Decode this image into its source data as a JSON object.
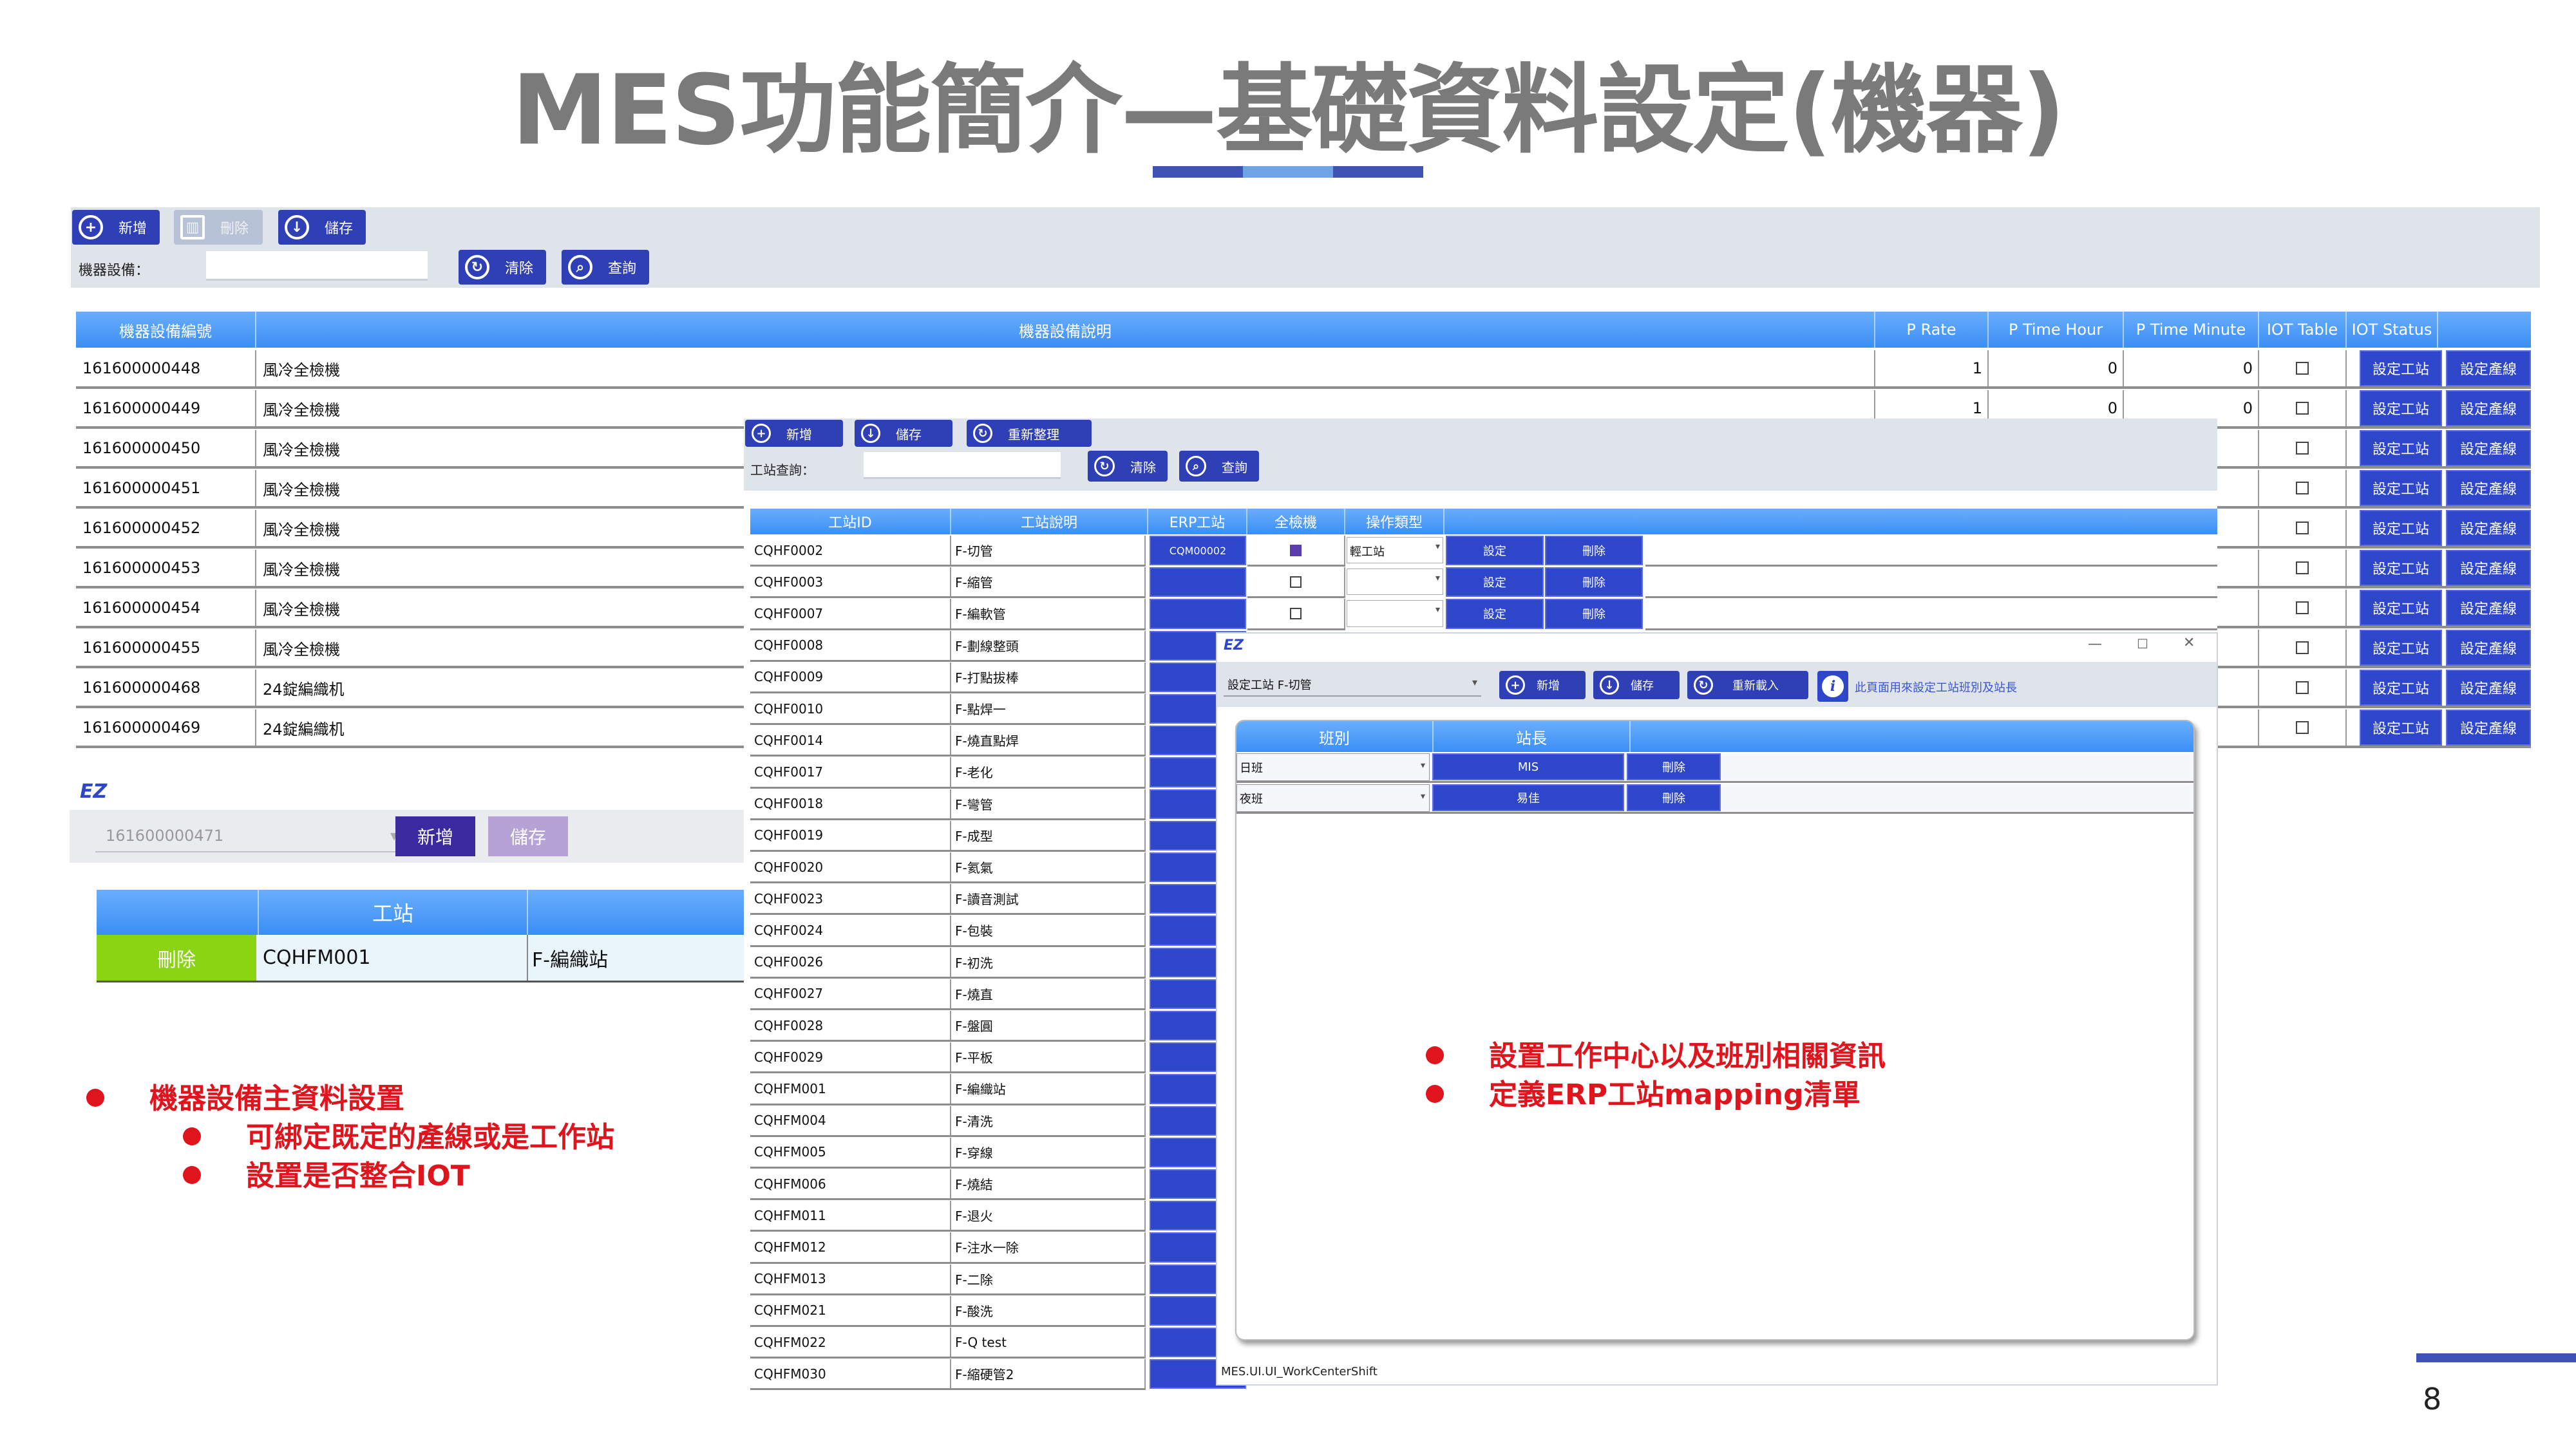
{
  "slide": {
    "title": "MES功能簡介—基礎資料設定(機器)",
    "title_bar_colors": [
      "#3e52b8",
      "#6ea4e6",
      "#3e52b8"
    ],
    "page_number": "8"
  },
  "machine_window": {
    "toolbar": {
      "add": "新增",
      "delete": "刪除",
      "save": "儲存",
      "clear": "清除",
      "query": "查詢"
    },
    "filter_label": "機器設備：",
    "columns": [
      "機器設備編號",
      "機器設備說明",
      "P Rate",
      "P Time Hour",
      "P Time Minute",
      "IOT Table",
      "IOT Status"
    ],
    "row_buttons": {
      "set_station": "設定工站",
      "set_line": "設定產線"
    },
    "rows": [
      {
        "id": "161600000448",
        "desc": "風冷全檢機",
        "rate": "1",
        "hour": "0",
        "minute": "0"
      },
      {
        "id": "161600000449",
        "desc": "風冷全檢機",
        "rate": "1",
        "hour": "0",
        "minute": "0"
      },
      {
        "id": "161600000450",
        "desc": "風冷全檢機"
      },
      {
        "id": "161600000451",
        "desc": "風冷全檢機"
      },
      {
        "id": "161600000452",
        "desc": "風冷全檢機"
      },
      {
        "id": "161600000453",
        "desc": "風冷全檢機"
      },
      {
        "id": "161600000454",
        "desc": "風冷全檢機"
      },
      {
        "id": "161600000455",
        "desc": "風冷全檢機"
      },
      {
        "id": "161600000468",
        "desc": "24錠編織机"
      },
      {
        "id": "161600000469",
        "desc": "24錠編織机"
      }
    ]
  },
  "station_form": {
    "logo": "EZ",
    "machine_select": "161600000471",
    "add": "新增",
    "save": "儲存",
    "column": "工站",
    "row": {
      "delete": "刪除",
      "code": "CQHFM001",
      "name": "F-編織站"
    }
  },
  "workstation_window": {
    "toolbar": {
      "add": "新增",
      "save": "儲存",
      "reorg": "重新整理",
      "clear": "清除",
      "query": "查詢"
    },
    "filter_label": "工站查詢：",
    "columns": [
      "工站ID",
      "工站說明",
      "ERP工站",
      "全檢機",
      "操作類型"
    ],
    "row_buttons": {
      "set": "設定",
      "delete": "刪除"
    },
    "first_row_extra": {
      "erp": "CQM00002",
      "op_type": "輕工站"
    },
    "rows": [
      {
        "id": "CQHF0002",
        "desc": "F-切管"
      },
      {
        "id": "CQHF0003",
        "desc": "F-縮管"
      },
      {
        "id": "CQHF0007",
        "desc": "F-編軟管"
      },
      {
        "id": "CQHF0008",
        "desc": "F-劃線整頭"
      },
      {
        "id": "CQHF0009",
        "desc": "F-打點拔棒"
      },
      {
        "id": "CQHF0010",
        "desc": "F-點焊一"
      },
      {
        "id": "CQHF0014",
        "desc": "F-燒直點焊"
      },
      {
        "id": "CQHF0017",
        "desc": "F-老化"
      },
      {
        "id": "CQHF0018",
        "desc": "F-彎管"
      },
      {
        "id": "CQHF0019",
        "desc": "F-成型"
      },
      {
        "id": "CQHF0020",
        "desc": "F-氦氣"
      },
      {
        "id": "CQHF0023",
        "desc": "F-讀音測試"
      },
      {
        "id": "CQHF0024",
        "desc": "F-包裝"
      },
      {
        "id": "CQHF0026",
        "desc": "F-初洗"
      },
      {
        "id": "CQHF0027",
        "desc": "F-燒直"
      },
      {
        "id": "CQHF0028",
        "desc": "F-盤圓"
      },
      {
        "id": "CQHF0029",
        "desc": "F-平板"
      },
      {
        "id": "CQHFM001",
        "desc": "F-編織站"
      },
      {
        "id": "CQHFM004",
        "desc": "F-清洗"
      },
      {
        "id": "CQHFM005",
        "desc": "F-穿線"
      },
      {
        "id": "CQHFM006",
        "desc": "F-燒結"
      },
      {
        "id": "CQHFM011",
        "desc": "F-退火"
      },
      {
        "id": "CQHFM012",
        "desc": "F-注水一除"
      },
      {
        "id": "CQHFM013",
        "desc": "F-二除"
      },
      {
        "id": "CQHFM021",
        "desc": "F-酸洗"
      },
      {
        "id": "CQHFM022",
        "desc": "F-Q test"
      },
      {
        "id": "CQHFM030",
        "desc": "F-縮硬管2"
      }
    ]
  },
  "shift_dialog": {
    "logo": "EZ",
    "window_controls": {
      "minimize": "—",
      "maximize": "☐",
      "close": "✕"
    },
    "station_select": "設定工站 F-切管",
    "add": "新增",
    "save": "儲存",
    "reload": "重新載入",
    "hint": "此頁面用來設定工站班別及站長",
    "columns": [
      "班別",
      "站長"
    ],
    "rows": [
      {
        "shift": "日班",
        "leader": "MIS",
        "delete": "刪除"
      },
      {
        "shift": "夜班",
        "leader": "易佳",
        "delete": "刪除"
      }
    ],
    "status": "MES.UI.UI_WorkCenterShift"
  },
  "bullets_left": [
    {
      "level": 1,
      "text": "機器設備主資料設置"
    },
    {
      "level": 2,
      "text": "可綁定既定的產線或是工作站"
    },
    {
      "level": 2,
      "text": "設置是否整合IOT"
    }
  ],
  "bullets_right": [
    {
      "level": 1,
      "text": "設置工作中心以及班別相關資訊"
    },
    {
      "level": 1,
      "text": "定義ERP工站mapping清單"
    }
  ]
}
